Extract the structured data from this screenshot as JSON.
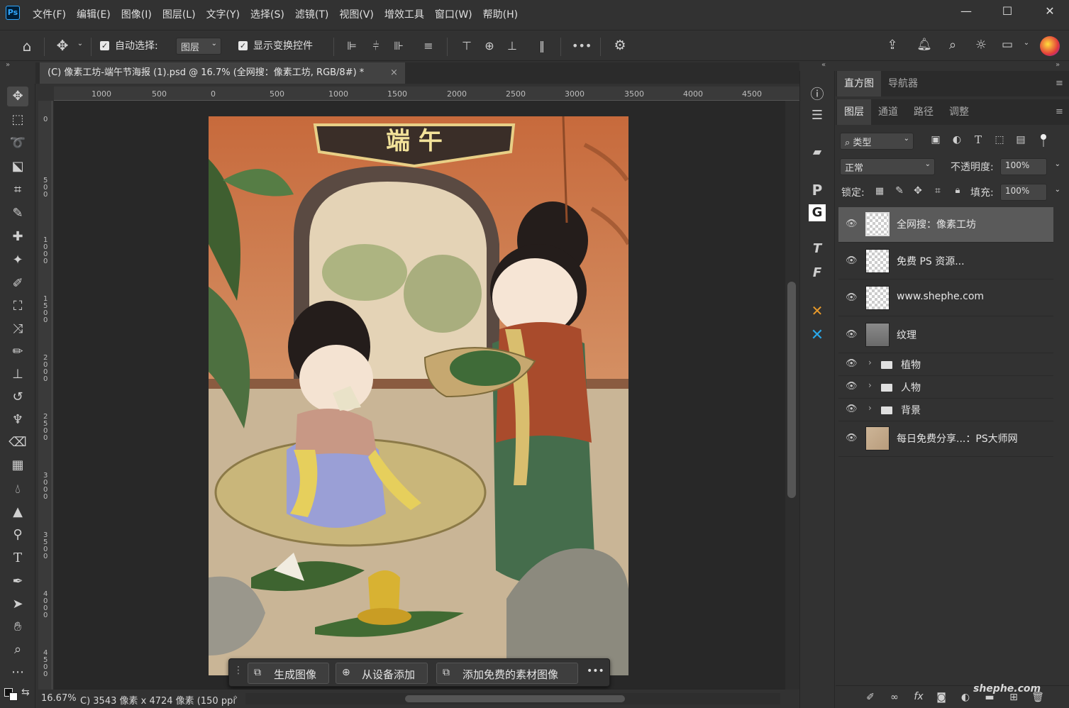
{
  "app": {
    "logo": "Ps",
    "menus": [
      "文件(F)",
      "编辑(E)",
      "图像(I)",
      "图层(L)",
      "文字(Y)",
      "选择(S)",
      "滤镜(T)",
      "视图(V)",
      "增效工具",
      "窗口(W)",
      "帮助(H)"
    ],
    "window_controls": [
      "minimize-icon",
      "maximize-icon",
      "close-icon"
    ]
  },
  "options": {
    "auto_select_label": "自动选择:",
    "auto_select_checked": true,
    "auto_select_value": "图层",
    "transform_label": "显示变换控件",
    "transform_checked": true,
    "more": "•••"
  },
  "document": {
    "tab_title": "(C) 像素工坊-端午节海报 (1).psd @ 16.7% (全网搜：像素工坊, RGB/8#) *",
    "close": "×"
  },
  "rulers": {
    "h_ticks": [
      "1000",
      "500",
      "0",
      "500",
      "1000",
      "1500",
      "2000",
      "2500",
      "3000",
      "3500",
      "4000",
      "4500"
    ],
    "v_ticks": [
      "0",
      "5\n0\n0",
      "1\n0\n0\n0",
      "1\n5\n0\n0",
      "2\n0\n0\n0",
      "2\n5\n0\n0",
      "3\n0\n0\n0",
      "3\n5\n0\n0",
      "4\n0\n0\n0",
      "4\n5\n0\n0"
    ]
  },
  "artwork": {
    "sign_text": "端  午"
  },
  "context_bar": {
    "generate": "生成图像",
    "from_device": "从设备添加",
    "free_assets": "添加免费的素材图像",
    "more": "•••"
  },
  "status": {
    "zoom": "16.67%",
    "info": "C) 3543 像素 x 4724 像素 (150 ppi",
    "arrow": "›"
  },
  "panels": {
    "top_tabs": [
      "直方图",
      "导航器"
    ],
    "layer_tabs": [
      "图层",
      "通道",
      "路径",
      "调整"
    ],
    "filter_label": "类型",
    "blend_mode": "正常",
    "opacity_label": "不透明度:",
    "opacity_value": "100%",
    "lock_label": "锁定:",
    "fill_label": "填充:",
    "fill_value": "100%",
    "layers": [
      {
        "name": "全网搜：像素工坊",
        "type": "layer",
        "selected": true
      },
      {
        "name": "免费 PS 资源...",
        "type": "layer",
        "selected": false
      },
      {
        "name": "www.shephe.com",
        "type": "layer",
        "selected": false
      },
      {
        "name": "纹理",
        "type": "texture",
        "selected": false
      },
      {
        "name": "植物",
        "type": "group",
        "selected": false
      },
      {
        "name": "人物",
        "type": "group",
        "selected": false
      },
      {
        "name": "背景",
        "type": "group",
        "selected": false
      },
      {
        "name": "每日免费分享...：PS大师网",
        "type": "image",
        "selected": false
      }
    ],
    "footer_icons": [
      "link-icon",
      "fx-icon",
      "mask-icon",
      "adjustment-icon",
      "group-icon",
      "new-layer-icon",
      "trash-icon"
    ],
    "watermark": "shephe.com"
  }
}
